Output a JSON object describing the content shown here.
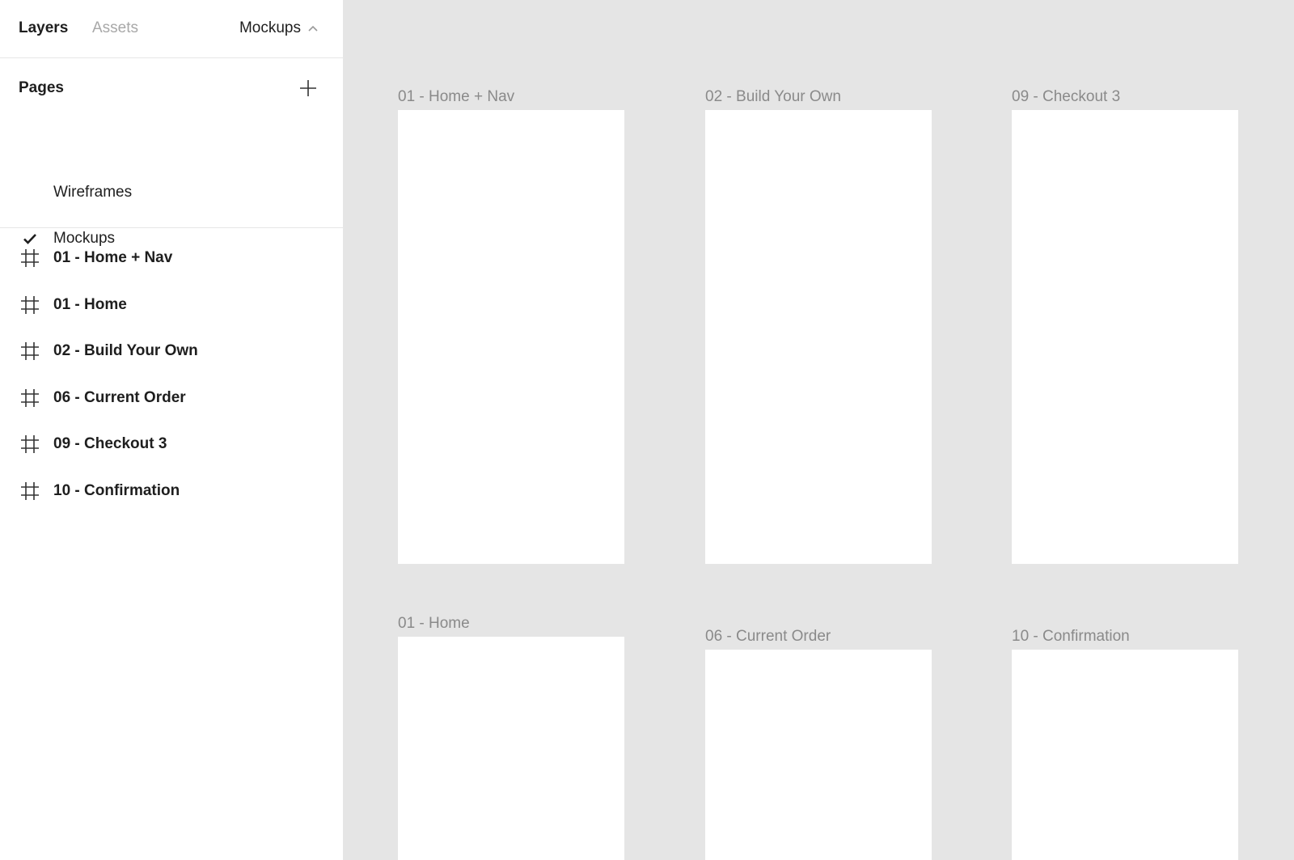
{
  "sidebar": {
    "tabs": {
      "layers": "Layers",
      "assets": "Assets"
    },
    "current_page": "Mockups",
    "pages": {
      "title": "Pages",
      "items": [
        {
          "label": "Wireframes",
          "selected": false
        },
        {
          "label": "Mockups",
          "selected": true
        }
      ]
    },
    "layers": [
      {
        "label": "01 - Home + Nav",
        "icon": "frame-icon"
      },
      {
        "label": "01 - Home",
        "icon": "frame-icon"
      },
      {
        "label": "02 - Build Your Own",
        "icon": "frame-icon"
      },
      {
        "label": "06 - Current Order",
        "icon": "frame-icon"
      },
      {
        "label": "09 - Checkout 3",
        "icon": "frame-icon"
      },
      {
        "label": "10 - Confirmation",
        "icon": "frame-icon"
      }
    ]
  },
  "canvas": {
    "background": "#e5e5e5",
    "frames": [
      {
        "title": "01 - Home + Nav"
      },
      {
        "title": "02 - Build Your Own"
      },
      {
        "title": "09 - Checkout 3"
      },
      {
        "title": "01 - Home"
      },
      {
        "title": "06 - Current Order"
      },
      {
        "title": "10 - Confirmation"
      }
    ]
  }
}
